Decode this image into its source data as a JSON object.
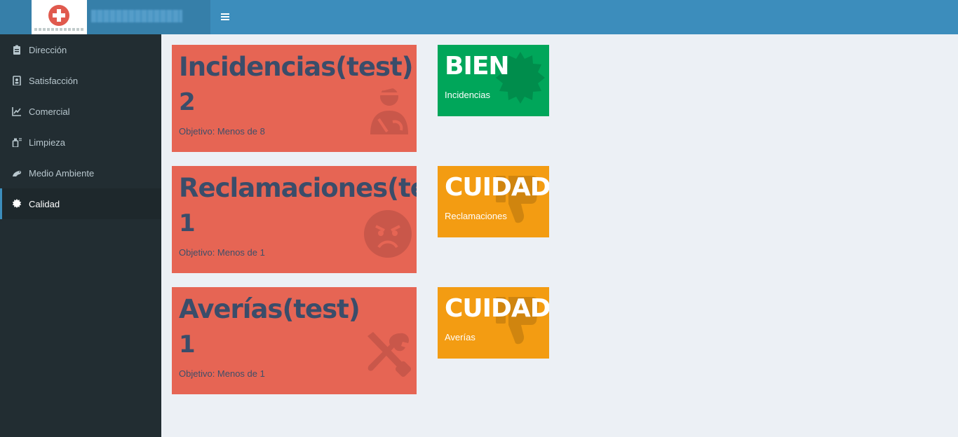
{
  "header": {
    "menu_toggle_label": "≡"
  },
  "sidebar": {
    "items": [
      {
        "label": "Dirección"
      },
      {
        "label": "Satisfacción"
      },
      {
        "label": "Comercial"
      },
      {
        "label": "Limpieza"
      },
      {
        "label": "Medio Ambiente"
      },
      {
        "label": "Calidad"
      }
    ],
    "active_index": 5
  },
  "kpis": [
    {
      "title": "Incidencias(test)",
      "value": "2",
      "goal": "Objetivo: Menos de 8",
      "icon": "injured-person-icon"
    },
    {
      "title": "Reclamaciones(test)",
      "value": "1",
      "goal": "Objetivo: Menos de 1",
      "icon": "angry-face-icon"
    },
    {
      "title": "Averías(test)",
      "value": "1",
      "goal": "Objetivo: Menos de 1",
      "icon": "tools-icon"
    }
  ],
  "statuses": [
    {
      "word": "BIEN",
      "caption": "Incidencias",
      "color": "#00a65a",
      "icon": "certificate-icon"
    },
    {
      "word": "CUIDADO",
      "caption": "Reclamaciones",
      "color": "#f39c12",
      "icon": "thumbs-down-icon"
    },
    {
      "word": "CUIDADO",
      "caption": "Averías",
      "color": "#f39c12",
      "icon": "thumbs-down-icon"
    }
  ],
  "colors": {
    "header": "#3c8dbc",
    "sidebar": "#222d32",
    "kpi_box": "#e66554",
    "content_bg": "#ecf0f5"
  }
}
